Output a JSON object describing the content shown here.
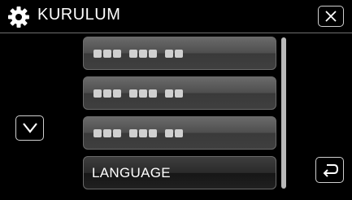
{
  "header": {
    "title": "KURULUM",
    "icon": "gear-icon"
  },
  "menu": {
    "items": [
      {
        "label": "",
        "placeholder": true
      },
      {
        "label": "",
        "placeholder": true
      },
      {
        "label": "",
        "placeholder": true
      },
      {
        "label": "LANGUAGE",
        "placeholder": false,
        "selected": true
      }
    ]
  },
  "controls": {
    "close_icon": "close-icon",
    "down_icon": "chevron-down-icon",
    "back_icon": "return-icon"
  },
  "colors": {
    "background": "#000000",
    "text": "#ffffff",
    "button_border": "#cfcfcf"
  }
}
